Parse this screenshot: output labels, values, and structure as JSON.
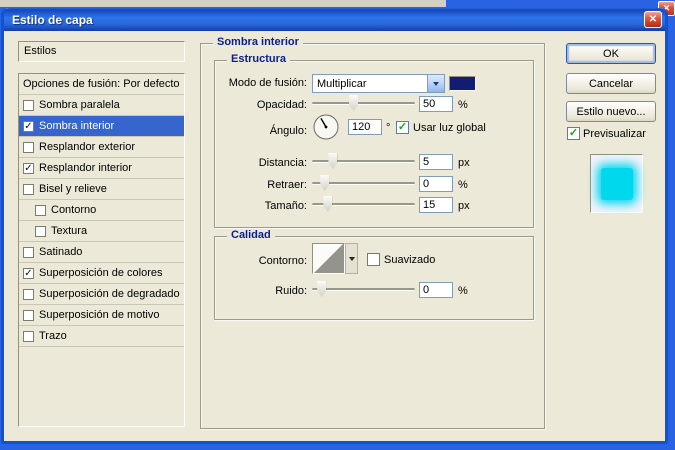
{
  "icons": {
    "close": "✕",
    "check": "✓"
  },
  "window": {
    "title": "Estilo de capa"
  },
  "left_panel": {
    "styles_label": "Estilos",
    "items": [
      {
        "label": "Opciones de fusión: Por defecto",
        "has_checkbox": false,
        "checked": false,
        "selected": false,
        "indent": false
      },
      {
        "label": "Sombra paralela",
        "has_checkbox": true,
        "checked": false,
        "selected": false,
        "indent": false
      },
      {
        "label": "Sombra interior",
        "has_checkbox": true,
        "checked": true,
        "selected": true,
        "indent": false
      },
      {
        "label": "Resplandor exterior",
        "has_checkbox": true,
        "checked": false,
        "selected": false,
        "indent": false
      },
      {
        "label": "Resplandor interior",
        "has_checkbox": true,
        "checked": true,
        "selected": false,
        "indent": false
      },
      {
        "label": "Bisel y relieve",
        "has_checkbox": true,
        "checked": false,
        "selected": false,
        "indent": false
      },
      {
        "label": "Contorno",
        "has_checkbox": true,
        "checked": false,
        "selected": false,
        "indent": true
      },
      {
        "label": "Textura",
        "has_checkbox": true,
        "checked": false,
        "selected": false,
        "indent": true
      },
      {
        "label": "Satinado",
        "has_checkbox": true,
        "checked": false,
        "selected": false,
        "indent": false
      },
      {
        "label": "Superposición de colores",
        "has_checkbox": true,
        "checked": true,
        "selected": false,
        "indent": false
      },
      {
        "label": "Superposición de degradado",
        "has_checkbox": true,
        "checked": false,
        "selected": false,
        "indent": false
      },
      {
        "label": "Superposición de motivo",
        "has_checkbox": true,
        "checked": false,
        "selected": false,
        "indent": false
      },
      {
        "label": "Trazo",
        "has_checkbox": true,
        "checked": false,
        "selected": false,
        "indent": false
      }
    ]
  },
  "main": {
    "legend": "Sombra interior",
    "structure": {
      "legend": "Estructura",
      "blend_mode": {
        "label": "Modo de fusión:",
        "value": "Multiplicar",
        "color": "#101d72"
      },
      "opacity": {
        "label": "Opacidad:",
        "value": "50",
        "unit": "%",
        "pos_pct": 36
      },
      "angle": {
        "label": "Ángulo:",
        "value": "120",
        "unit": "°",
        "global_light_label": "Usar luz global",
        "global_light_checked": true
      },
      "distance": {
        "label": "Distancia:",
        "value": "5",
        "unit": "px",
        "pos_pct": 16
      },
      "choke": {
        "label": "Retraer:",
        "value": "0",
        "unit": "%",
        "pos_pct": 8
      },
      "size": {
        "label": "Tamaño:",
        "value": "15",
        "unit": "px",
        "pos_pct": 11
      }
    },
    "quality": {
      "legend": "Calidad",
      "contour": {
        "label": "Contorno:"
      },
      "antialias": {
        "label": "Suavizado",
        "checked": false
      },
      "noise": {
        "label": "Ruido:",
        "value": "0",
        "unit": "%",
        "pos_pct": 5
      }
    }
  },
  "right_panel": {
    "ok_label": "OK",
    "cancel_label": "Cancelar",
    "new_style_label": "Estilo nuevo...",
    "preview_label": "Previsualizar",
    "preview_checked": true,
    "preview_color": "#00d8ee"
  }
}
